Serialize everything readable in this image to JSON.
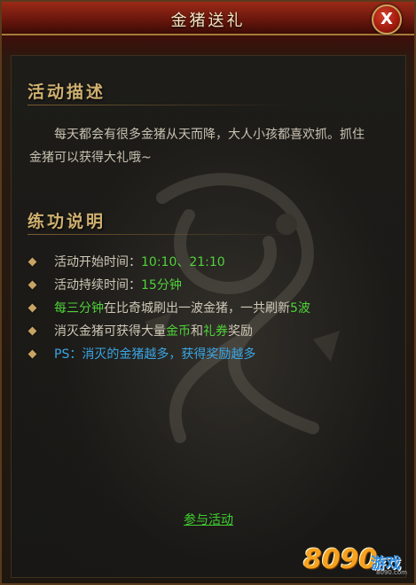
{
  "window": {
    "title": "金猪送礼",
    "close_label": "X"
  },
  "description_section": {
    "title": "活动描述",
    "text": "每天都会有很多金猪从天而降，大人小孩都喜欢抓。抓住金猪可以获得大礼哦~"
  },
  "rules_section": {
    "title": "练功说明",
    "items": [
      {
        "parts": [
          {
            "text": "活动开始时间：",
            "color": "normal"
          },
          {
            "text": "10:10、21:10",
            "color": "green"
          }
        ]
      },
      {
        "parts": [
          {
            "text": "活动持续时间：",
            "color": "normal"
          },
          {
            "text": "15分钟",
            "color": "green"
          }
        ]
      },
      {
        "parts": [
          {
            "text": "每三分钟",
            "color": "green"
          },
          {
            "text": "在比奇城刷出一波金猪，一共刷新",
            "color": "normal"
          },
          {
            "text": "5波",
            "color": "green"
          }
        ]
      },
      {
        "parts": [
          {
            "text": "消灭金猪可获得大量",
            "color": "normal"
          },
          {
            "text": "金币",
            "color": "green"
          },
          {
            "text": "和",
            "color": "normal"
          },
          {
            "text": "礼券",
            "color": "green"
          },
          {
            "text": "奖励",
            "color": "normal"
          }
        ]
      },
      {
        "parts": [
          {
            "text": "PS：消灭的金猪越多，获得奖励越多",
            "color": "blue"
          }
        ]
      }
    ]
  },
  "actions": {
    "join_label": "参与活动"
  },
  "watermark": {
    "number": "8090",
    "text": "游戏",
    "url": "8090.com"
  },
  "colors": {
    "highlight_green": "#4fd23a",
    "highlight_blue": "#39a6e6",
    "section_gold": "#cfb06f"
  }
}
